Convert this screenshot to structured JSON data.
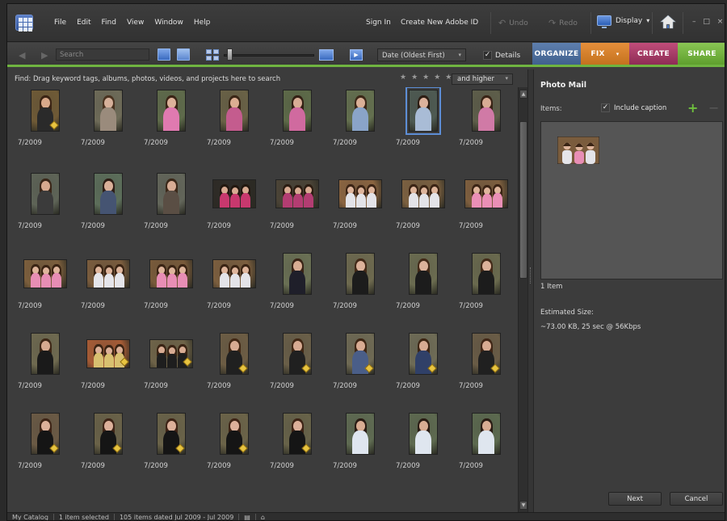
{
  "menubar": {
    "app_icon": "organizer-grid-icon",
    "menus": [
      "File",
      "Edit",
      "Find",
      "View",
      "Window",
      "Help"
    ],
    "sign_in": "Sign In",
    "create_id": "Create New Adobe ID",
    "undo": "Undo",
    "redo": "Redo",
    "display": "Display",
    "display_caret": "▾",
    "window_controls": "– □ ×"
  },
  "toolbar": {
    "back_forward": "◀ ▶",
    "search_placeholder": "Search",
    "play_icon": "▶",
    "sort_value": "Date (Oldest First)",
    "caret": "▾",
    "details_label": "Details",
    "details_checked": "✓"
  },
  "tabs": [
    "ORGANIZE",
    "FIX",
    "CREATE",
    "SHARE"
  ],
  "fix_caret": "▾",
  "findbar": {
    "instruction": "Find: Drag keyword tags, albums, photos, videos, and projects here to search",
    "stars": "★★★★★",
    "rating_value": "and higher"
  },
  "grid": {
    "date_label": "7/2009",
    "selected_index": 6,
    "thumbnails": [
      {
        "o": "p",
        "c": "#6f5a36",
        "f": "#d9a98a",
        "h": "#3b2414",
        "b": "#2a2a2a",
        "tag": true
      },
      {
        "o": "p",
        "c": "#6e6b58",
        "f": "#d6b09a",
        "h": "#4a3320",
        "b": "#9a8b7c"
      },
      {
        "o": "p",
        "c": "#5f6b4b",
        "f": "#dcb29a",
        "h": "#3a2416",
        "b": "#e07ab0"
      },
      {
        "o": "p",
        "c": "#6a6246",
        "f": "#dcae92",
        "h": "#3a2616",
        "b": "#c45c8e"
      },
      {
        "o": "p",
        "c": "#5d6a48",
        "f": "#d8ad95",
        "h": "#332014",
        "b": "#d06a9f"
      },
      {
        "o": "p",
        "c": "#64704f",
        "f": "#dab097",
        "h": "#3c2818",
        "b": "#8aa4c8"
      },
      {
        "o": "p",
        "c": "#4e5a52",
        "f": "#dcb29c",
        "h": "#2d1e14",
        "b": "#a9bcd6"
      },
      {
        "o": "p",
        "c": "#5e5e4a",
        "f": "#d7ac94",
        "h": "#392416",
        "b": "#d07aa6"
      },
      {
        "o": "p",
        "c": "#5e6457",
        "f": "#d7a98e",
        "h": "#3a2618",
        "b": "#3b3b3b"
      },
      {
        "o": "p",
        "c": "#5c6e5a",
        "f": "#d9b099",
        "h": "#2e1e16",
        "b": "#455472"
      },
      {
        "o": "p",
        "c": "#63665a",
        "f": "#d7ac94",
        "h": "#3b2819",
        "b": "#5a4e44"
      },
      {
        "o": "l",
        "c": "#2d2a25",
        "f": "#d8ab92",
        "h": "#221810",
        "b": "#c8386e"
      },
      {
        "o": "l",
        "c": "#4a4336",
        "f": "#d8ab92",
        "h": "#2c1d12",
        "b": "#b33d72"
      },
      {
        "o": "l",
        "c": "#8a6440",
        "f": "#deb59c",
        "h": "#3b2415",
        "b": "#e3e3e8"
      },
      {
        "o": "l",
        "c": "#7b6040",
        "f": "#deb59c",
        "h": "#3b2415",
        "b": "#e3e3e8"
      },
      {
        "o": "l",
        "c": "#7d5e3e",
        "f": "#deb59c",
        "h": "#3b2415",
        "b": "#ea8fb6"
      },
      {
        "o": "l",
        "c": "#7b5e3c",
        "f": "#deb59c",
        "h": "#3a2414",
        "b": "#e78db4"
      },
      {
        "o": "l",
        "c": "#7a5c3d",
        "f": "#deb59c",
        "h": "#3a2414",
        "b": "#e5e5ea"
      },
      {
        "o": "l",
        "c": "#785a3a",
        "f": "#deb59c",
        "h": "#3a2414",
        "b": "#e88eb5"
      },
      {
        "o": "l",
        "c": "#7b5e3e",
        "f": "#deb59c",
        "h": "#3a2414",
        "b": "#e3e3e8"
      },
      {
        "o": "p",
        "c": "#6a7054",
        "f": "#d9ad93",
        "h": "#3a2416",
        "b": "#1f1f2a"
      },
      {
        "o": "p",
        "c": "#6e6a4f",
        "f": "#dcb29a",
        "h": "#432a18",
        "b": "#1c1c1c"
      },
      {
        "o": "p",
        "c": "#6b6c50",
        "f": "#dcb29a",
        "h": "#432a18",
        "b": "#1c1c1c"
      },
      {
        "o": "p",
        "c": "#6a6a4e",
        "f": "#dcb29a",
        "h": "#432a18",
        "b": "#1c1c1c"
      },
      {
        "o": "p",
        "c": "#6f6a50",
        "f": "#d6aa90",
        "h": "#3e2716",
        "b": "#1a1a1a"
      },
      {
        "o": "l",
        "c": "#a55b35",
        "f": "#dcb097",
        "h": "#3c2414",
        "b": "#d8c070",
        "tag": true
      },
      {
        "o": "l",
        "c": "#6e6348",
        "f": "#d8ac93",
        "h": "#3a2414",
        "b": "#1e1e1e",
        "tag": true
      },
      {
        "o": "p",
        "c": "#6d5d44",
        "f": "#d8ab92",
        "h": "#422815",
        "b": "#202020",
        "tag": true
      },
      {
        "o": "p",
        "c": "#6a5f48",
        "f": "#d8ab92",
        "h": "#422815",
        "b": "#202020",
        "tag": true
      },
      {
        "o": "p",
        "c": "#6f6a54",
        "f": "#d8ab92",
        "h": "#3e2614",
        "b": "#4a5e88",
        "tag": true
      },
      {
        "o": "p",
        "c": "#6f6c56",
        "f": "#d8ab92",
        "h": "#3e2614",
        "b": "#304068",
        "tag": true
      },
      {
        "o": "p",
        "c": "#6a5c46",
        "f": "#d8ab92",
        "h": "#402616",
        "b": "#202020",
        "tag": true
      },
      {
        "o": "p",
        "c": "#6b5a45",
        "f": "#dcb09a",
        "h": "#3e2416",
        "b": "#151515",
        "tag": true
      },
      {
        "o": "p",
        "c": "#6a6248",
        "f": "#dcb09a",
        "h": "#3e2416",
        "b": "#151515",
        "tag": true
      },
      {
        "o": "p",
        "c": "#6a6349",
        "f": "#dcb09a",
        "h": "#3e2416",
        "b": "#151515",
        "tag": true
      },
      {
        "o": "p",
        "c": "#6c6449",
        "f": "#dcb09a",
        "h": "#3e2416",
        "b": "#151515",
        "tag": true
      },
      {
        "o": "p",
        "c": "#686349",
        "f": "#dcb09a",
        "h": "#3e2416",
        "b": "#151515",
        "tag": true
      },
      {
        "o": "p",
        "c": "#5f6b52",
        "f": "#d9ad93",
        "h": "#2a1c14",
        "b": "#dfe6ef"
      },
      {
        "o": "p",
        "c": "#5e6a50",
        "f": "#d9ad93",
        "h": "#2a1c14",
        "b": "#dfe6ef"
      },
      {
        "o": "p",
        "c": "#5c6a4f",
        "f": "#d9ad93",
        "h": "#2a1c14",
        "b": "#dfe6ef"
      }
    ]
  },
  "panel": {
    "title": "Photo Mail",
    "items_label": "Items:",
    "include_caption": "Include caption",
    "include_checked": "✓",
    "add": "+",
    "remove": "−",
    "item_count": "1 Item",
    "estimated_label": "Estimated Size:",
    "estimated_value": "~73.00 KB, 25 sec @ 56Kbps",
    "next": "Next",
    "cancel": "Cancel"
  },
  "status": {
    "catalog": "My Catalog",
    "selected": "1 item selected",
    "range": "105 items dated Jul 2009 - Jul 2009"
  },
  "colors": {
    "accent_green": "#6fb440",
    "organize": "#4f6f9d",
    "fix": "#d88030",
    "create": "#a83c68",
    "share": "#72b140",
    "selection": "#5d8ed6"
  }
}
